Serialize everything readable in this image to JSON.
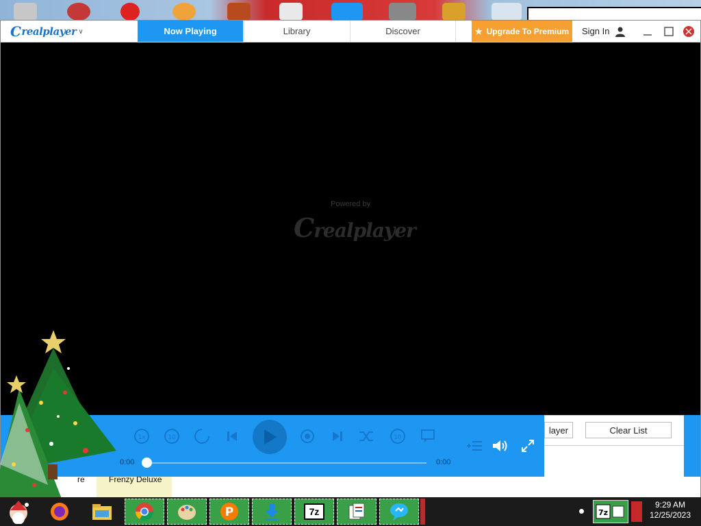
{
  "app": {
    "name": "realplayer"
  },
  "tabs": [
    {
      "label": "Now Playing",
      "active": true
    },
    {
      "label": "Library",
      "active": false
    },
    {
      "label": "Discover",
      "active": false
    }
  ],
  "header": {
    "premium_label": "Upgrade To Premium",
    "signin_label": "Sign In"
  },
  "video": {
    "powered_by": "Powered by",
    "watermark": "realplayer"
  },
  "player": {
    "time_elapsed": "0:00",
    "time_total": "0:00",
    "progress": 0
  },
  "playlist": {
    "player_button": "layer",
    "clear_button": "Clear List"
  },
  "desktop": {
    "label_left": "re",
    "label_right": "Frenzy Deluxe"
  },
  "taskbar": {
    "time": "9:29 AM",
    "date": "12/25/2023",
    "sevenzip": "7z"
  },
  "colors": {
    "accent": "#1e97f3",
    "premium": "#f5a030",
    "taskbar_tile": "#3aa048"
  }
}
